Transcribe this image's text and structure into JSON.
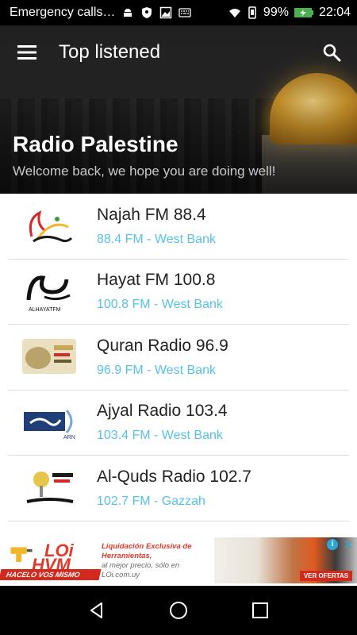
{
  "status_bar": {
    "carrier": "Emergency calls…",
    "battery": "99%",
    "time": "22:04",
    "icons": [
      "android-debug-icon",
      "shield-icon",
      "image-icon",
      "keyboard-icon",
      "wifi-icon",
      "vibrate-icon",
      "battery-charging-icon"
    ]
  },
  "toolbar": {
    "title": "Top listened",
    "menu_icon": "menu-icon",
    "search_icon": "search-icon"
  },
  "header": {
    "title": "Radio Palestine",
    "subtitle": "Welcome back, we hope you are doing well!"
  },
  "stations": [
    {
      "name": "Najah FM 88.4",
      "subtitle": "88.4 FM - West Bank",
      "logo": "najah-fm-logo"
    },
    {
      "name": "Hayat FM 100.8",
      "subtitle": "100.8 FM - West Bank",
      "logo": "hayat-fm-logo",
      "logo_caption": "ALHAYATFM"
    },
    {
      "name": "Quran Radio 96.9",
      "subtitle": "96.9 FM - West Bank",
      "logo": "quran-radio-logo"
    },
    {
      "name": "Ajyal Radio 103.4",
      "subtitle": "103.4 FM - West Bank",
      "logo": "ajyal-radio-logo",
      "logo_caption": "ARN"
    },
    {
      "name": "Al-Quds Radio 102.7",
      "subtitle": "102.7 FM - Gazzah",
      "logo": "al-quds-radio-logo"
    }
  ],
  "ad": {
    "brand_top": "LOi",
    "brand_bottom": "HVM",
    "tagline": "HACELO VOS MISMO",
    "headline": "Liquidación Exclusiva de Herramientas,",
    "body": "al mejor precio, sólo en LOi.com.uy",
    "cta": "VER OFERTAS",
    "info_icon": "i",
    "close_icon": "✕"
  },
  "colors": {
    "accent_subtitle": "#55c2e6",
    "ad_red": "#d42a1e",
    "status_bar": "#000000"
  },
  "nav_bar": {
    "icons": [
      "back-icon",
      "home-icon",
      "recents-icon"
    ]
  }
}
